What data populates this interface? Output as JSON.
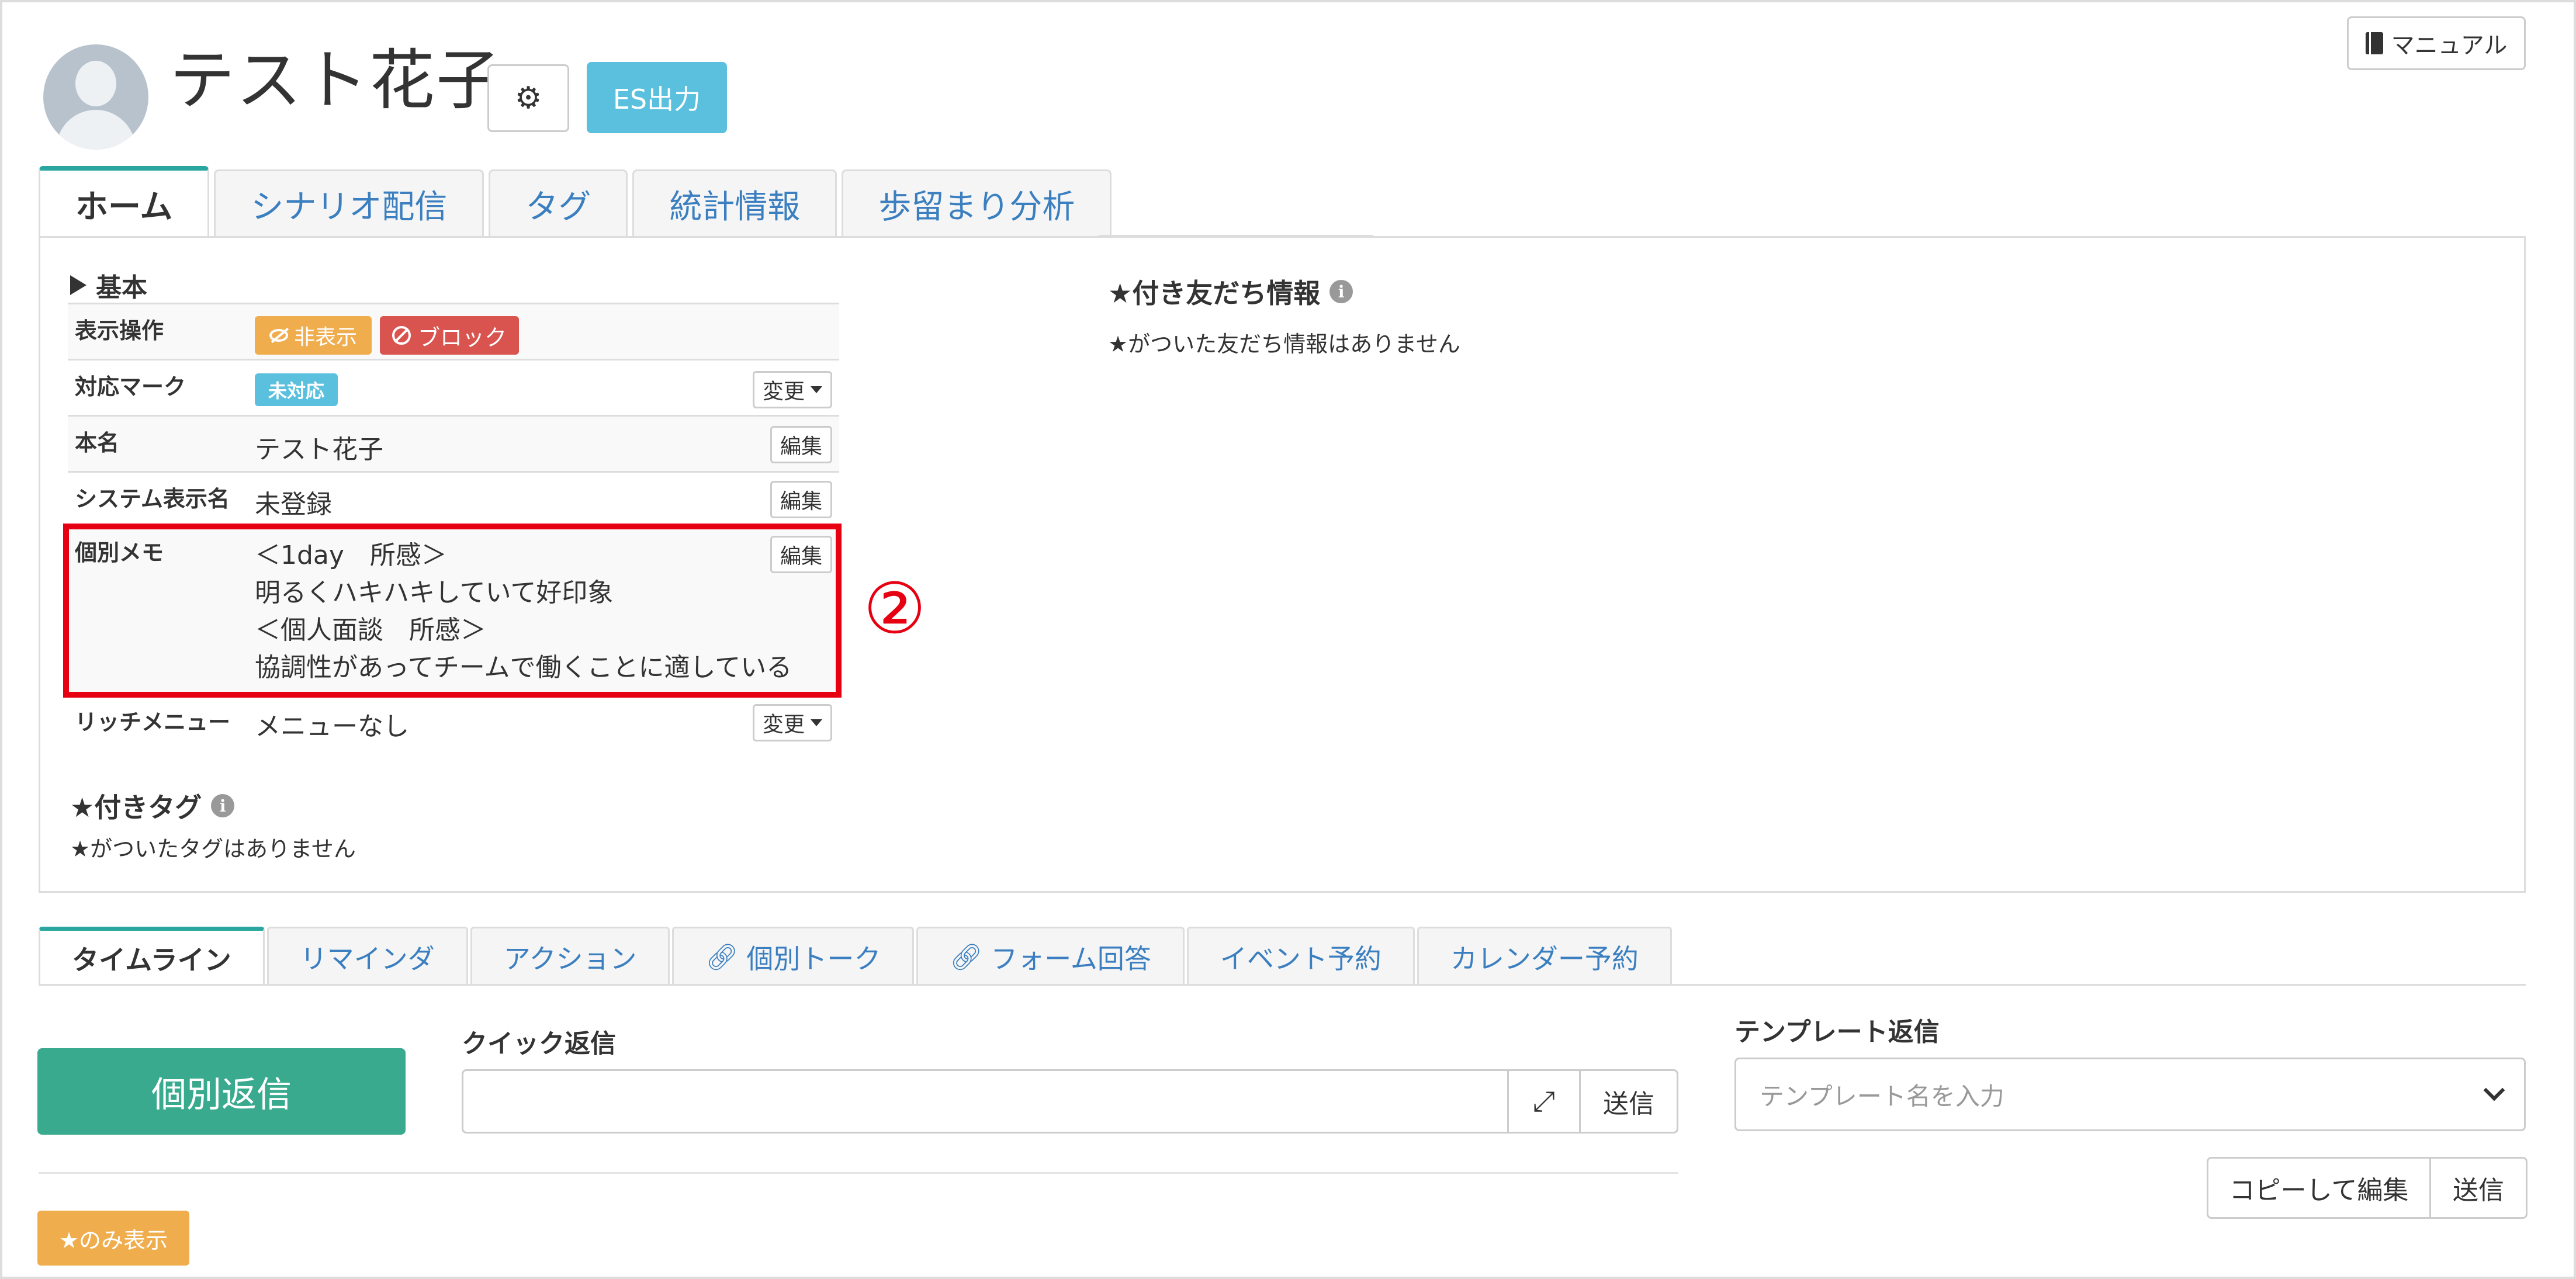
{
  "header": {
    "name": "テスト花子",
    "settings_icon": "gear-icon",
    "es_export_label": "ES出力",
    "manual_label": "マニュアル",
    "manual_icon": "book-icon"
  },
  "main_tabs": [
    {
      "label": "ホーム",
      "active": true
    },
    {
      "label": "シナリオ配信",
      "active": false
    },
    {
      "label": "タグ",
      "active": false
    },
    {
      "label": "統計情報",
      "active": false
    },
    {
      "label": "歩留まり分析",
      "active": false
    }
  ],
  "basic": {
    "section_title": "基本",
    "rows": {
      "display_ops": {
        "label": "表示操作",
        "hide_label": "非表示",
        "block_label": "ブロック"
      },
      "status_mark": {
        "label": "対応マーク",
        "badge": "未対応",
        "change_label": "変更"
      },
      "real_name": {
        "label": "本名",
        "value": "テスト花子",
        "edit_label": "編集"
      },
      "system_name": {
        "label": "システム表示名",
        "value": "未登録",
        "edit_label": "編集"
      },
      "memo": {
        "label": "個別メモ",
        "edit_label": "編集",
        "lines": [
          "＜1day　所感＞",
          "明るくハキハキしていて好印象",
          "＜個人面談　所感＞",
          "協調性があってチームで働くことに適している"
        ]
      },
      "rich_menu": {
        "label": "リッチメニュー",
        "value": "メニューなし",
        "change_label": "変更"
      }
    }
  },
  "annotation": {
    "number": "②",
    "color": "#e60012"
  },
  "starred_tags": {
    "title": "★付きタグ",
    "empty": "★がついたタグはありません"
  },
  "starred_friends": {
    "title": "★付き友だち情報",
    "empty": "★がついた友だち情報はありません"
  },
  "bottom_tabs": [
    {
      "label": "タイムライン",
      "active": true,
      "link_icon": false
    },
    {
      "label": "リマインダ",
      "active": false,
      "link_icon": false
    },
    {
      "label": "アクション",
      "active": false,
      "link_icon": false
    },
    {
      "label": "個別トーク",
      "active": false,
      "link_icon": true
    },
    {
      "label": "フォーム回答",
      "active": false,
      "link_icon": true
    },
    {
      "label": "イベント予約",
      "active": false,
      "link_icon": false
    },
    {
      "label": "カレンダー予約",
      "active": false,
      "link_icon": false
    }
  ],
  "reply": {
    "individual_reply_label": "個別返信",
    "quick_reply_label": "クイック返信",
    "quick_input_value": "",
    "quick_send_label": "送信",
    "expand_icon": "expand-icon",
    "template_reply_label": "テンプレート返信",
    "template_placeholder": "テンプレート名を入力",
    "copy_edit_label": "コピーして編集",
    "template_send_label": "送信",
    "star_only_label": "★のみ表示"
  },
  "colors": {
    "accent_teal": "#2aa6a0",
    "reply_green": "#3aaa8f",
    "info_blue": "#5bc0de",
    "warning_orange": "#f0ad4e",
    "danger_red": "#d9534f",
    "link_blue": "#3b7fc0"
  }
}
